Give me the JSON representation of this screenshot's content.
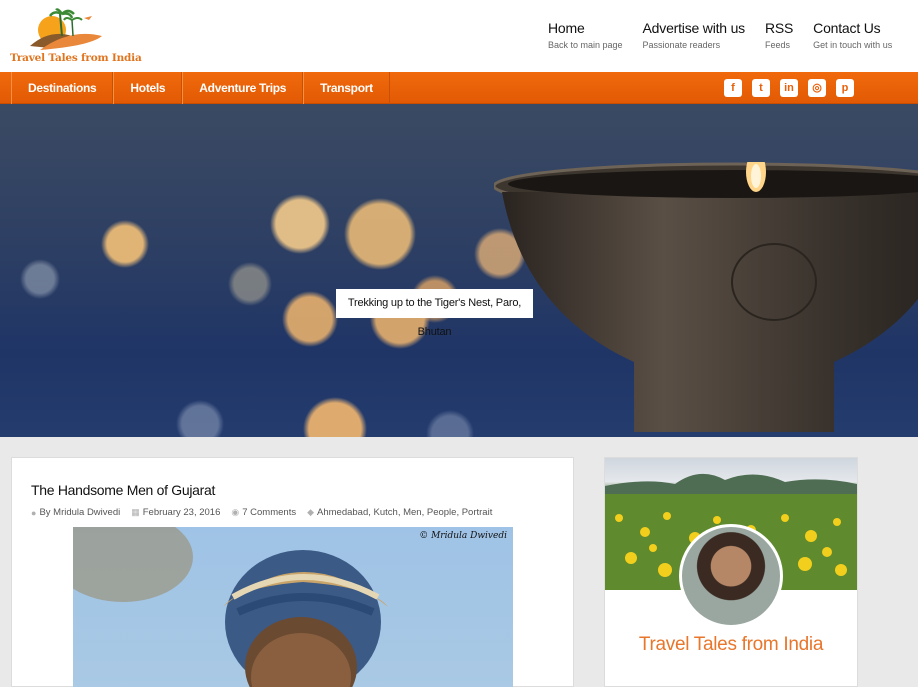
{
  "header": {
    "logo_text": "Travel Tales from India",
    "nav": [
      {
        "title": "Home",
        "subtitle": "Back to main page"
      },
      {
        "title": "Advertise with us",
        "subtitle": "Passionate readers"
      },
      {
        "title": "RSS",
        "subtitle": "Feeds"
      },
      {
        "title": "Contact Us",
        "subtitle": "Get in touch with us"
      }
    ]
  },
  "menu": {
    "items": [
      "Destinations",
      "Hotels",
      "Adventure Trips",
      "Transport"
    ],
    "social_icons": [
      "facebook-icon",
      "twitter-icon",
      "linkedin-icon",
      "instagram-icon",
      "pinterest-icon"
    ],
    "color": "#e8600a"
  },
  "hero": {
    "caption": "Trekking up to the Tiger's Nest, Paro, Bhutan"
  },
  "post": {
    "title": "The Handsome Men of Gujarat",
    "author": "By Mridula Dwivedi",
    "date": "February 23, 2016",
    "comments": "7 Comments",
    "tags": "Ahmedabad, Kutch, Men, People, Portrait",
    "watermark": "© Mridula Dwivedi"
  },
  "sidebar": {
    "title": "Travel Tales from India"
  }
}
